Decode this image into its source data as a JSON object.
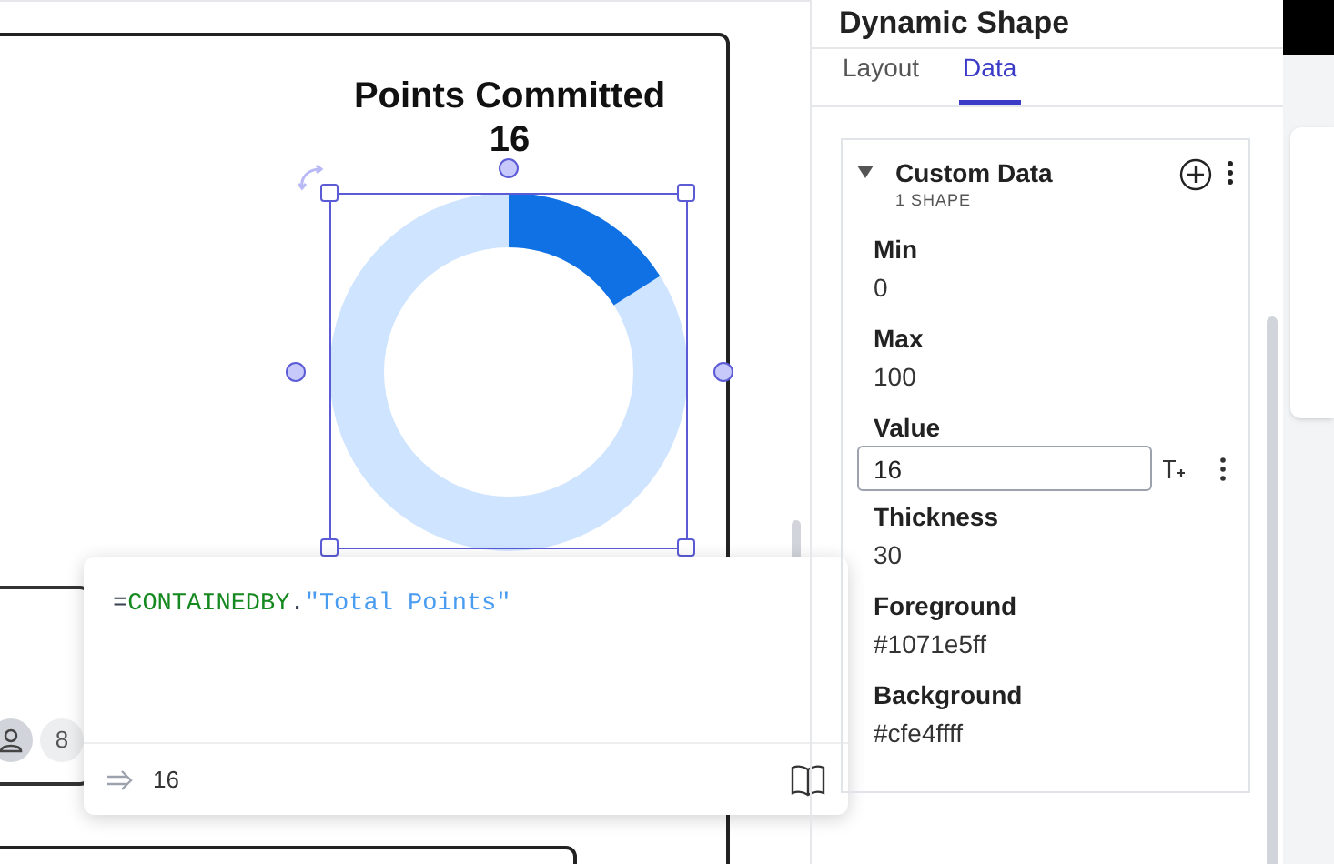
{
  "canvas": {
    "card": {
      "title": "Points Committed",
      "value": "16"
    },
    "side_card": {
      "count": "8"
    }
  },
  "formula_popup": {
    "formula": [
      {
        "kind": "operator",
        "text": "="
      },
      {
        "kind": "function",
        "text": "CONTAINEDBY"
      },
      {
        "kind": "operator",
        "text": "."
      },
      {
        "kind": "string",
        "text": "\"Total Points\""
      }
    ],
    "result": "16"
  },
  "panel": {
    "title": "Dynamic Shape",
    "tabs": [
      {
        "label": "Layout",
        "selected": false
      },
      {
        "label": "Data",
        "selected": true
      }
    ],
    "section": {
      "title": "Custom Data",
      "subtitle": "1 SHAPE",
      "expanded": true,
      "fields": [
        {
          "kind": "text",
          "label": "Min",
          "value": "0"
        },
        {
          "kind": "text",
          "label": "Max",
          "value": "100"
        },
        {
          "kind": "input",
          "label": "Value",
          "value": "16"
        },
        {
          "kind": "text",
          "label": "Thickness",
          "value": "30"
        },
        {
          "kind": "text",
          "label": "Foreground",
          "value": "#1071e5ff"
        },
        {
          "kind": "text",
          "label": "Background",
          "value": "#cfe4ffff"
        }
      ]
    }
  }
}
